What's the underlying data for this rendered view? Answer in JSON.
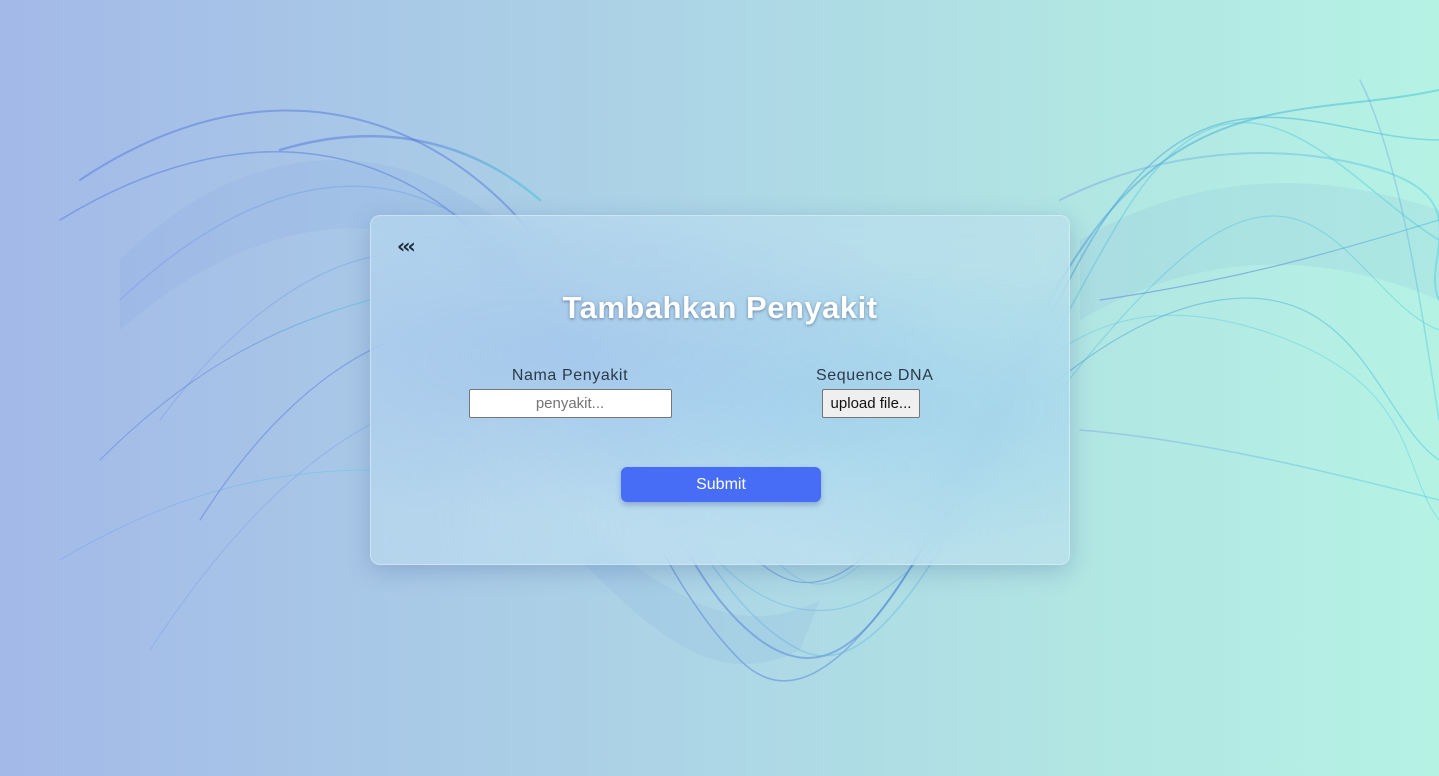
{
  "form": {
    "back_label": "‹‹‹",
    "title": "Tambahkan Penyakit",
    "name_label": "Nama Penyakit",
    "name_placeholder": "penyakit...",
    "name_value": "",
    "dna_label": "Sequence DNA",
    "upload_label": "upload file...",
    "submit_label": "Submit"
  },
  "colors": {
    "submit": "#476cf5",
    "background_left": "#a3b9e8",
    "background_right": "#b5f2e4"
  }
}
